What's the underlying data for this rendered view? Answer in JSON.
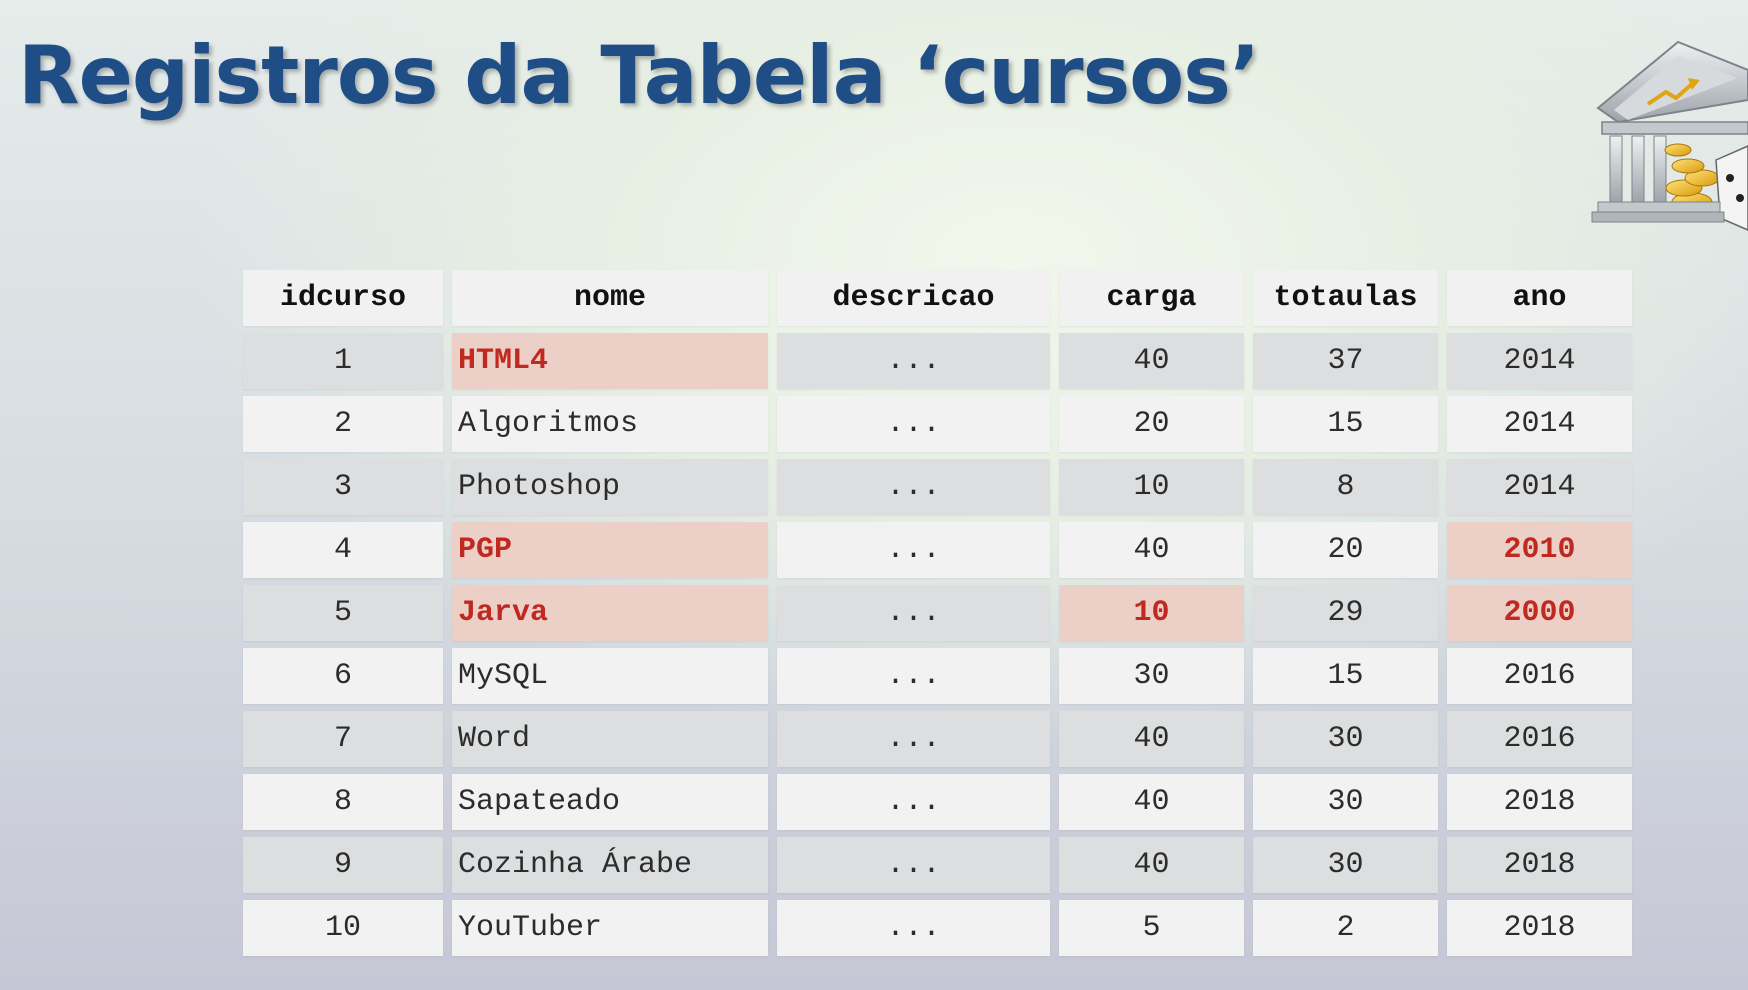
{
  "title": "Registros da Tabela ‘cursos’",
  "colors": {
    "title": "#1f4d86",
    "highlight_text": "#c0291f",
    "highlight_bg": "#ecd0c8",
    "row_odd": "#dcdedf",
    "row_even": "#f2f2f2"
  },
  "icons": {
    "logo": "bank-building-with-coins-and-dice-icon"
  },
  "table": {
    "headers": [
      "idcurso",
      "nome",
      "descricao",
      "carga",
      "totaulas",
      "ano"
    ],
    "rows": [
      {
        "cells": [
          "1",
          "HTML4",
          "...",
          "40",
          "37",
          "2014"
        ],
        "highlight": [
          1
        ]
      },
      {
        "cells": [
          "2",
          "Algoritmos",
          "...",
          "20",
          "15",
          "2014"
        ],
        "highlight": []
      },
      {
        "cells": [
          "3",
          "Photoshop",
          "...",
          "10",
          "8",
          "2014"
        ],
        "highlight": []
      },
      {
        "cells": [
          "4",
          "PGP",
          "...",
          "40",
          "20",
          "2010"
        ],
        "highlight": [
          1,
          5
        ]
      },
      {
        "cells": [
          "5",
          "Jarva",
          "...",
          "10",
          "29",
          "2000"
        ],
        "highlight": [
          1,
          3,
          5
        ]
      },
      {
        "cells": [
          "6",
          "MySQL",
          "...",
          "30",
          "15",
          "2016"
        ],
        "highlight": []
      },
      {
        "cells": [
          "7",
          "Word",
          "...",
          "40",
          "30",
          "2016"
        ],
        "highlight": []
      },
      {
        "cells": [
          "8",
          "Sapateado",
          "...",
          "40",
          "30",
          "2018"
        ],
        "highlight": []
      },
      {
        "cells": [
          "9",
          "Cozinha Árabe",
          "...",
          "40",
          "30",
          "2018"
        ],
        "highlight": []
      },
      {
        "cells": [
          "10",
          "YouTuber",
          "...",
          "5",
          "2",
          "2018"
        ],
        "highlight": []
      }
    ]
  }
}
